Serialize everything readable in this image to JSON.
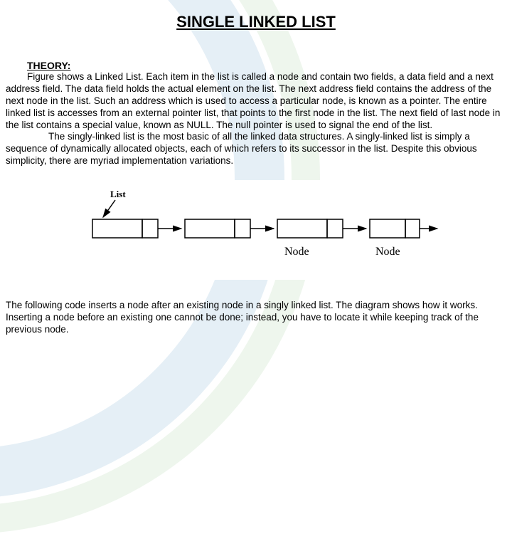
{
  "title": "SINGLE LINKED LIST",
  "theory_label": "THEORY:",
  "para1_first": "Figure shows a Linked List. Each item in the list is called a node and contain two fields, a data field and a next address field. The data field holds the actual element on the list. The next address field contains the address of the next node in the list. Such an address which is used to access a particular node, is known as a pointer. The entire linked list is accesses from an external pointer list, that points to the first node in the list. The next field of last node in the list contains a special value, known as NULL. The null pointer is used to signal the end of the list.",
  "para2": "The singly-linked list is the most basic of all the linked data structures. A singly-linked list is simply a sequence of dynamically allocated objects, each of which refers to its successor in the list. Despite this obvious simplicity, there are myriad implementation variations.",
  "diagram": {
    "list_label": "List",
    "node_label_1": "Node",
    "node_label_2": "Node"
  },
  "para3": "The following code inserts a node after an existing node in a singly linked list. The diagram shows how it works. Inserting a node before an existing one cannot be done; instead, you have to locate it while keeping track of the previous node."
}
